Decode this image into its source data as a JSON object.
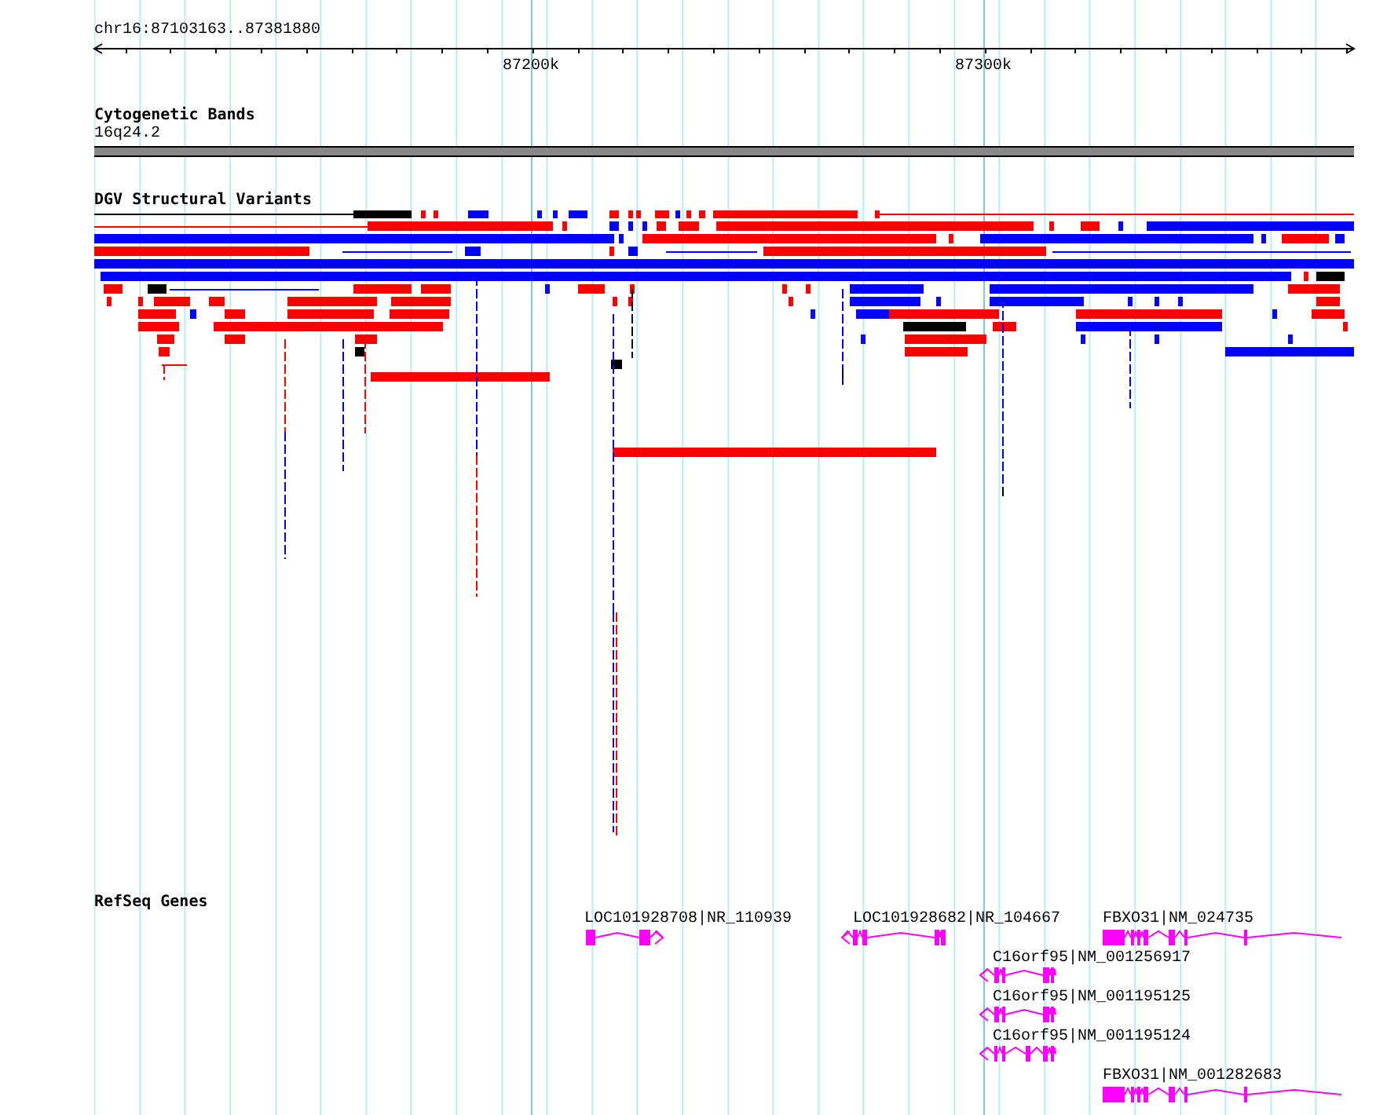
{
  "ruler": {
    "position": "chr16:87103163..87381880",
    "ticks": [
      "87200k",
      "87300k"
    ]
  },
  "tracks": [
    {
      "kind": "bands",
      "title": "Cytogenetic Bands",
      "band_label": "16q24.2"
    },
    {
      "kind": "variants",
      "title": "DGV Structural Variants"
    },
    {
      "kind": "genes",
      "title": "RefSeq Genes",
      "genes": [
        {
          "label": "LOC101928708|NR_110939"
        },
        {
          "label": "LOC101928682|NR_104667"
        },
        {
          "label": "FBXO31|NM_024735"
        },
        {
          "label": "C16orf95|NM_001256917"
        },
        {
          "label": "C16orf95|NM_001195125"
        },
        {
          "label": "C16orf95|NM_001195124"
        },
        {
          "label": "FBXO31|NM_001282683"
        }
      ]
    }
  ]
}
